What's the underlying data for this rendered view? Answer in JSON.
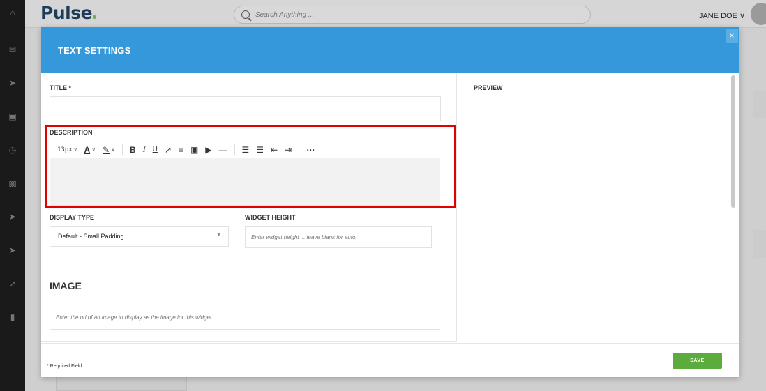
{
  "app": {
    "logo": "Pulse",
    "search_placeholder": "Search Anything ...",
    "user_name": "JANE DOE",
    "user_chevron": "∨"
  },
  "rail_icons": [
    "home-icon",
    "mail-icon",
    "send-icon",
    "calendar-icon",
    "clock-icon",
    "image-icon",
    "rocket-icon",
    "rocket-icon",
    "chart-icon",
    "book-icon"
  ],
  "modal": {
    "title": "TEXT SETTINGS",
    "close_glyph": "×",
    "title_label": "TITLE *",
    "title_value": "",
    "description_label": "DESCRIPTION",
    "toolbar": {
      "font_size": "13px",
      "font_color_glyph": "A",
      "highlight_glyph": "✎",
      "buttons": [
        "B",
        "I",
        "U",
        "↗",
        "≡",
        "▣",
        "▶",
        "—",
        "☰",
        "☰",
        "⇤",
        "⇥",
        "⋯"
      ]
    },
    "description_value": "",
    "display_type_label": "DISPLAY TYPE",
    "display_type_value": "Default - Small Padding",
    "widget_height_label": "WIDGET HEIGHT",
    "widget_height_placeholder": "Enter widget height ... leave blank for auto.",
    "image_heading": "IMAGE",
    "image_url_placeholder": "Enter the url of an image to display as the image for this widget.",
    "preview_label": "PREVIEW",
    "required_note": "* Required Field",
    "save_label": "SAVE"
  },
  "colors": {
    "header": "#3498db",
    "save": "#5cac3d",
    "highlight_box": "#e30000"
  }
}
